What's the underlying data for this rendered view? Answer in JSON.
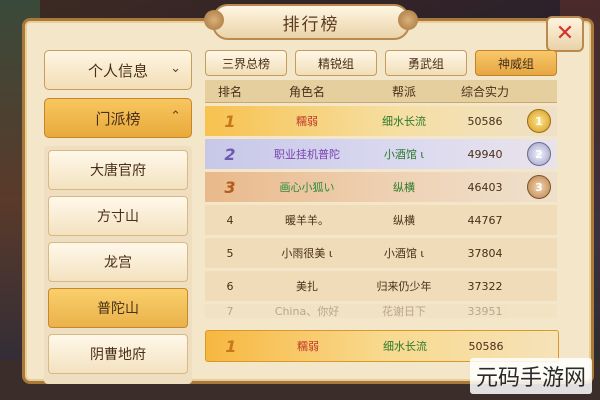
{
  "window": {
    "title": "排行榜",
    "close_label": "✕"
  },
  "left_menu": {
    "personal_info": "个人信息",
    "sect_ranking": "门派榜",
    "sects": [
      "大唐官府",
      "方寸山",
      "龙宫",
      "普陀山",
      "阴曹地府"
    ],
    "selected_sect": "普陀山"
  },
  "tabs": [
    "三界总榜",
    "精锐组",
    "勇武组",
    "神威组"
  ],
  "selected_tab": "神威组",
  "table": {
    "headers": [
      "排名",
      "角色名",
      "帮派",
      "综合实力"
    ],
    "rows": [
      {
        "rank": "1",
        "name": "糯弱",
        "guild": "细水长流",
        "power": "50586",
        "medal": "gold"
      },
      {
        "rank": "2",
        "name": "职业挂机普陀",
        "guild": "小酒馆 ι",
        "power": "49940",
        "medal": "silver"
      },
      {
        "rank": "3",
        "name": "画心小狐い",
        "guild": "纵横",
        "power": "46403",
        "medal": "bronze"
      },
      {
        "rank": "4",
        "name": "暖羊羊。",
        "guild": "纵横",
        "power": "44767"
      },
      {
        "rank": "5",
        "name": "小雨很美 ι",
        "guild": "小酒馆 ι",
        "power": "37804"
      },
      {
        "rank": "6",
        "name": "美扎",
        "guild": "归来仍少年",
        "power": "37322"
      },
      {
        "rank": "7",
        "name": "China、你好",
        "guild": "花谢日下",
        "power": "33951"
      }
    ],
    "my_row": {
      "rank": "1",
      "name": "糯弱",
      "guild": "细水长流",
      "power": "50586"
    }
  },
  "watermark": "元码手游网"
}
